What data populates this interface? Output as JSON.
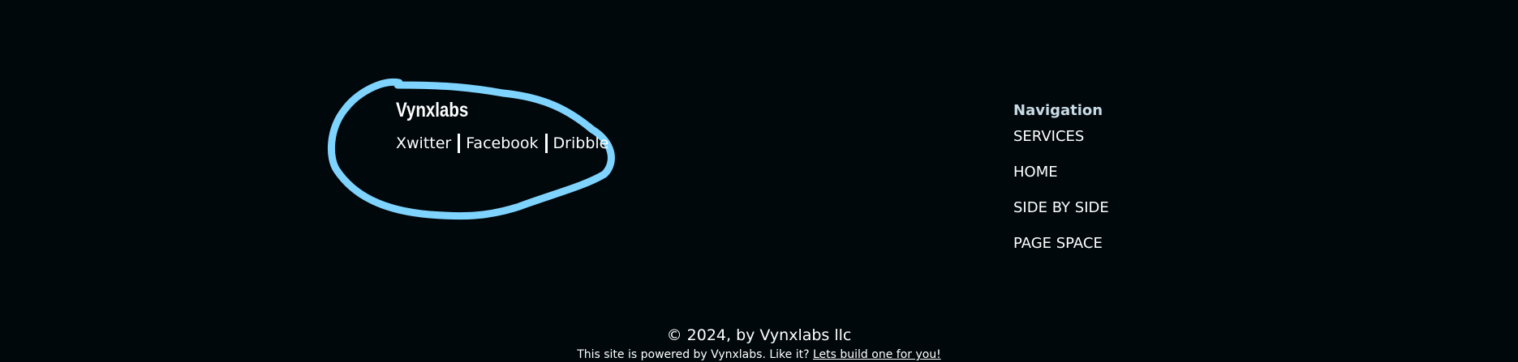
{
  "brand": {
    "title": "Vynxlabs",
    "social": [
      {
        "label": "Xwitter"
      },
      {
        "label": "Facebook"
      },
      {
        "label": "Dribble"
      }
    ]
  },
  "navigation": {
    "heading": "Navigation",
    "items": [
      {
        "label": "SERVICES"
      },
      {
        "label": "HOME"
      },
      {
        "label": "SIDE BY SIDE"
      },
      {
        "label": "PAGE SPACE"
      }
    ]
  },
  "footer": {
    "copyright": "© 2024, by Vynxlabs llc",
    "powered_text": "This site is powered by Vynxlabs. Like it?",
    "powered_link": "Lets build one for you!"
  },
  "colors": {
    "background": "#00080b",
    "annotation": "#7fd4ff",
    "heading": "#c9dbe6"
  }
}
